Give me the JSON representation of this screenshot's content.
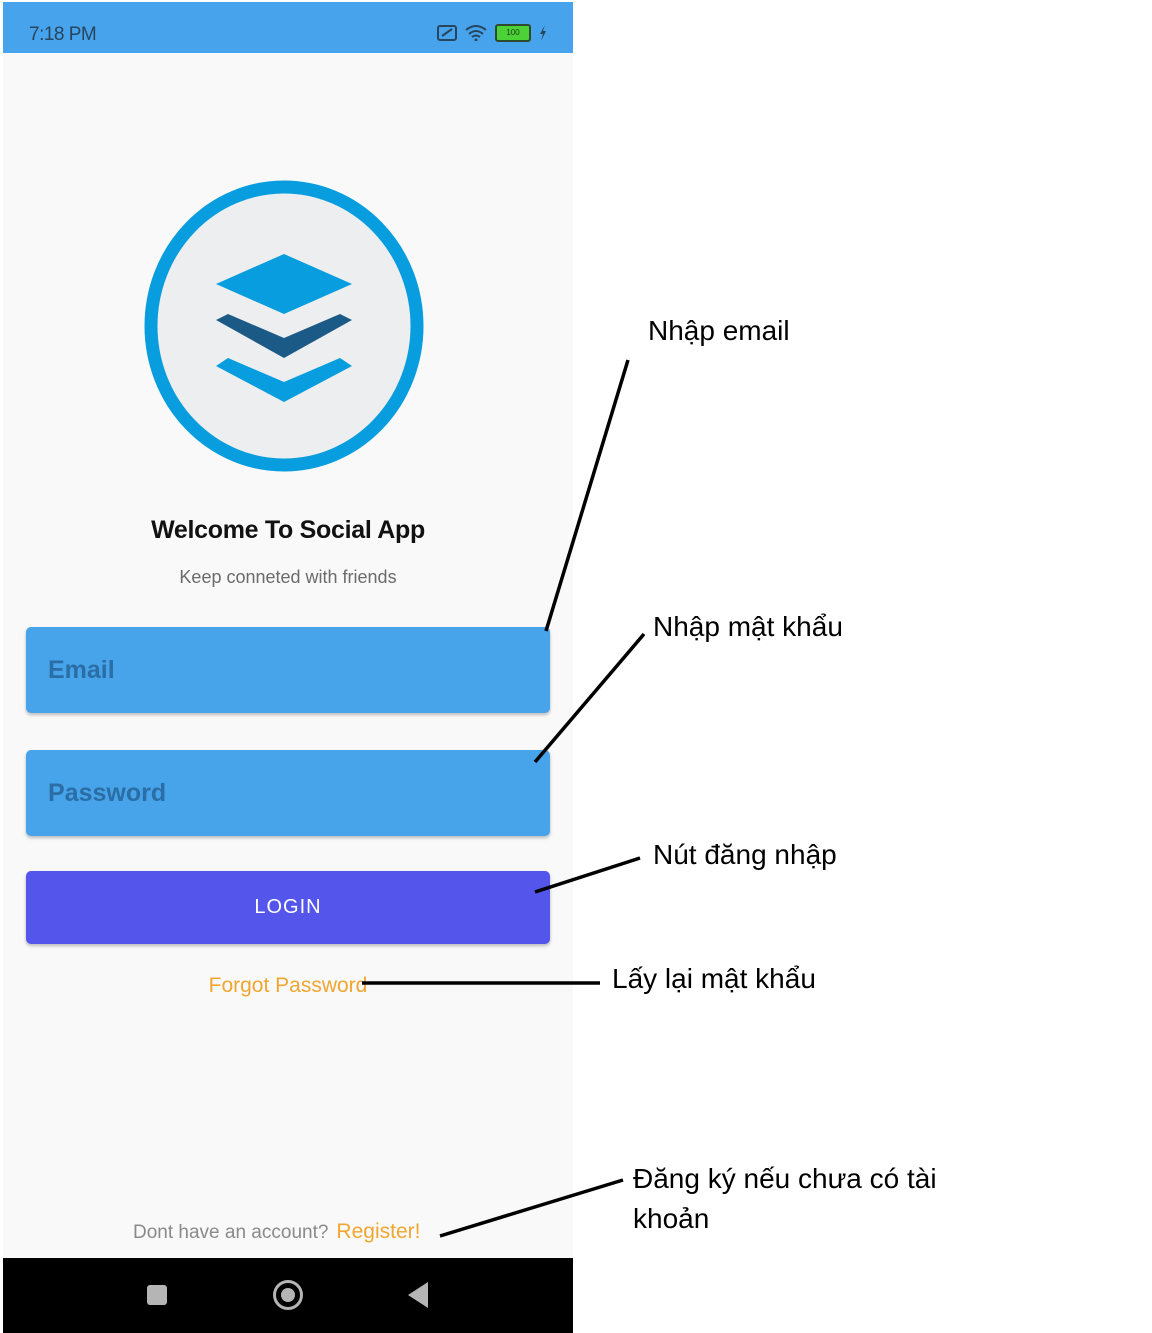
{
  "status_bar": {
    "time": "7:18 PM",
    "battery_level": "100",
    "icons": [
      "sim-icon",
      "wifi-icon",
      "battery-icon",
      "charging-icon"
    ]
  },
  "logo": {
    "icon": "layers-icon",
    "colors": {
      "ring": "#079ddf",
      "inner": "#eceeef",
      "light_layer": "#079ddf",
      "dark_layer": "#1b5a86"
    }
  },
  "welcome": {
    "title": "Welcome To Social App",
    "subtitle": "Keep conneted with friends"
  },
  "form": {
    "email_placeholder": "Email",
    "password_placeholder": "Password",
    "login_label": "LOGIN",
    "forgot_label": "Forgot Password"
  },
  "footer": {
    "prompt": "Dont have an account?",
    "register_label": "Register!"
  },
  "colors": {
    "status_bar": "#47a3ec",
    "field_bg": "#47a3ea",
    "login_button": "#5355eb",
    "link": "#f0a630"
  },
  "annotations": {
    "email": "Nhập email",
    "password": "Nhập mật khẩu",
    "login": "Nút đăng nhập",
    "forgot": "Lấy lại mật khẩu",
    "register_line1": "Đăng ký nếu chưa có tài",
    "register_line2": "khoản"
  }
}
